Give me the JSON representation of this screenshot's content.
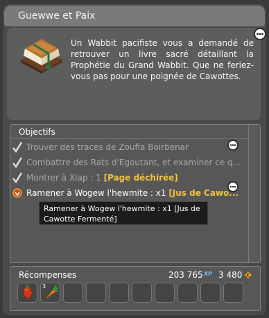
{
  "window": {
    "title": "Guewwe et Paix"
  },
  "description": {
    "text": "Un Wabbit pacifiste vous a demandé de retrouver un livre sacré détaillant la Prophétie du Grand Wabbit. Que ne feriez-vous pas pour une poignée de Cawottes."
  },
  "objectives": {
    "header": "Objectifs",
    "items": [
      {
        "text": "Trouver des traces de Zoufia Boirbenar",
        "highlight": "",
        "status": "done"
      },
      {
        "text": "Combattre des Rats d'Egoutant, et examiner ce q...",
        "highlight": "",
        "status": "done"
      },
      {
        "text": "Montrer à Xiap : 1 ",
        "highlight": "[Page déchirée]",
        "status": "done"
      },
      {
        "text": "Ramener à Wogew l'hewmite : x1 ",
        "highlight": "[Jus de Cawo...",
        "status": "active"
      }
    ],
    "tooltip": "Ramener à Wogew l'hewmite : x1 [Jus de Cawotte Fermenté]"
  },
  "rewards": {
    "label": "Récompenses",
    "xp_value": "203 765",
    "xp_unit": "XP",
    "kamas_value": "3 480",
    "items": [
      {
        "icon": "red-pepper-icon",
        "count": ""
      },
      {
        "icon": "carrot-icon",
        "count": "3"
      }
    ],
    "empty_slots": 8
  },
  "colors": {
    "highlight": "#f0c33c",
    "done_text": "#a8a8a8",
    "panel": "#4a4a4a",
    "title_bar": "#7a7a7a"
  }
}
